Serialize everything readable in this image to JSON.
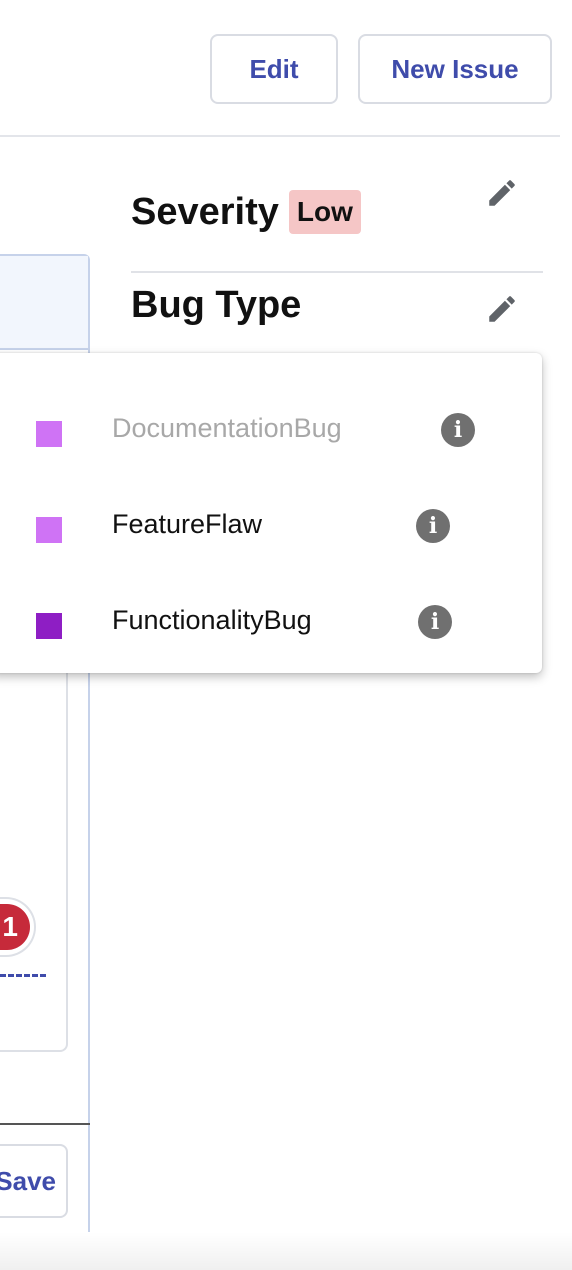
{
  "header": {
    "edit_label": "Edit",
    "new_issue_label": "New Issue"
  },
  "left": {
    "counter": "1",
    "save_label": "Save"
  },
  "severity": {
    "title": "Severity",
    "value": "Low",
    "badge_color": "#f5c6c6",
    "edit_icon": "pencil-icon"
  },
  "bug_type": {
    "title": "Bug Type",
    "edit_icon": "pencil-icon",
    "options": [
      {
        "label": "DocumentationBug",
        "color": "#cf73f5",
        "disabled": true,
        "icon": "info-icon"
      },
      {
        "label": "FeatureFlaw",
        "color": "#cf73f5",
        "disabled": false,
        "icon": "info-icon"
      },
      {
        "label": "FunctionalityBug",
        "color": "#8e1ec4",
        "disabled": false,
        "icon": "info-icon"
      }
    ]
  },
  "colors": {
    "accent": "#3f4cab",
    "badge_red": "#c62a3a"
  }
}
